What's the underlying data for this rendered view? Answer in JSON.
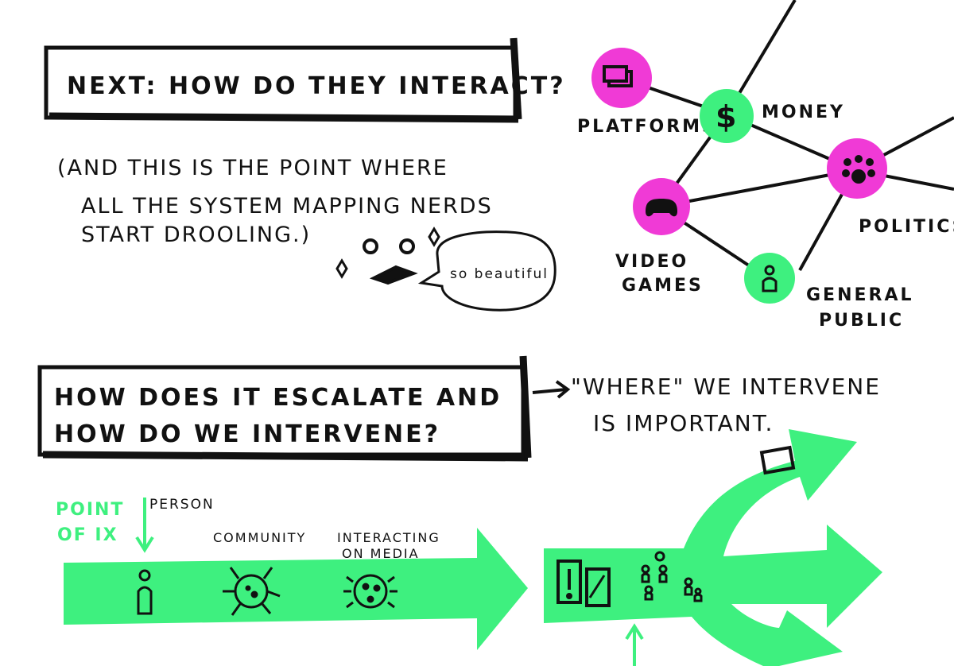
{
  "colors": {
    "green": "#3ef07f",
    "magenta": "#f03ad6",
    "ink": "#111111",
    "paper": "#ffffff"
  },
  "section1": {
    "title": "NEXT: HOW DO THEY INTERACT?",
    "note_line1": "(AND THIS IS THE POINT WHERE",
    "note_line2": "ALL THE SYSTEM MAPPING NERDS",
    "note_line3": "START DROOLING.)",
    "speech": "so beautiful"
  },
  "network": {
    "platforms": "PLATFORMS",
    "money": "MONEY",
    "politics": "POLITICS",
    "video_games_1": "VIDEO",
    "video_games_2": "GAMES",
    "general_public_1": "GENERAL",
    "general_public_2": "PUBLIC",
    "money_symbol": "$"
  },
  "section2": {
    "title_line1": "HOW DOES IT ESCALATE AND",
    "title_line2": "HOW DO WE INTERVENE?",
    "note_line1": "\"WHERE\" WE INTERVENE",
    "note_line2": "IS IMPORTANT."
  },
  "escalation": {
    "point_of_ix_1": "POINT",
    "point_of_ix_2": "OF IX",
    "person": "PERSON",
    "community": "COMMUNITY",
    "interacting_1": "INTERACTING",
    "interacting_2": "ON MEDIA"
  }
}
